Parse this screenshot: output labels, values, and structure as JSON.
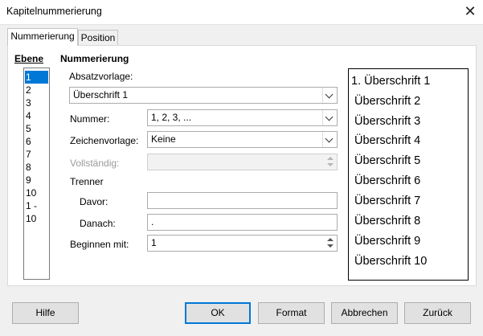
{
  "window": {
    "title": "Kapitelnummerierung",
    "close_glyph": "✕"
  },
  "tabs": [
    {
      "label": "Nummerierung",
      "active": true
    },
    {
      "label": "Position",
      "active": false
    }
  ],
  "levels": {
    "header": "Ebene",
    "items": [
      "1",
      "2",
      "3",
      "4",
      "5",
      "6",
      "7",
      "8",
      "9",
      "10",
      "1 - 10"
    ],
    "selected_index": 0
  },
  "numbering": {
    "section_title": "Nummerierung",
    "paragraph_style_label": "Absatzvorlage:",
    "paragraph_style_value": "Überschrift 1",
    "number_label": "Nummer:",
    "number_value": "1, 2, 3, ...",
    "char_style_label": "Zeichenvorlage:",
    "char_style_value": "Keine",
    "full_label": "Vollständig:",
    "full_value": "",
    "separator_title": "Trenner",
    "before_label": "Davor:",
    "before_value": "",
    "after_label": "Danach:",
    "after_value": ".",
    "start_label": "Beginnen mit:",
    "start_value": "1"
  },
  "preview": [
    "1. Überschrift 1",
    "Überschrift 2",
    "Überschrift 3",
    "Überschrift 4",
    "Überschrift 5",
    "Überschrift 6",
    "Überschrift 7",
    "Überschrift 8",
    "Überschrift 9",
    "Überschrift 10"
  ],
  "buttons": {
    "help": "Hilfe",
    "ok": "OK",
    "format": "Format",
    "cancel": "Abbrechen",
    "back": "Zurück"
  },
  "colors": {
    "selection": "#0078d7",
    "dialog_bg": "#f0f0f0"
  }
}
